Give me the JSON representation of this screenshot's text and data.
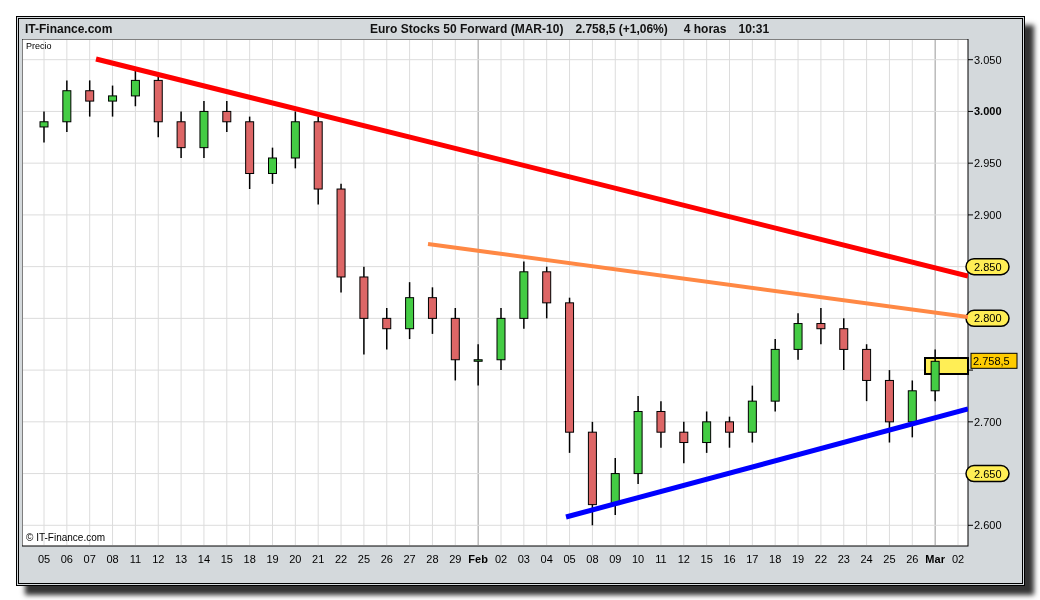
{
  "header": {
    "site": "IT-Finance.com",
    "title": "Euro Stocks 50 Forward (MAR-10)",
    "quote": "2.758,5 (+1,06%)",
    "interval": "4 horas",
    "time": "10:31"
  },
  "chart": {
    "panel_label": "Precio",
    "copyright": "© IT-Finance.com",
    "current_price": "2.758,5",
    "price_tick_bold": [
      false,
      true,
      false,
      false,
      false,
      false,
      false,
      false,
      false
    ],
    "price_tick_marked": [
      false,
      false,
      false,
      false,
      true,
      true,
      false,
      true,
      false
    ],
    "date_bold": [
      false,
      false,
      false,
      false,
      false,
      false,
      false,
      false,
      false,
      false,
      false,
      false,
      false,
      false,
      false,
      false,
      false,
      false,
      false,
      true,
      false,
      false,
      false,
      false,
      false,
      false,
      false,
      false,
      false,
      false,
      false,
      false,
      false,
      false,
      false,
      false,
      false,
      false,
      false,
      true,
      false
    ],
    "chart_data": {
      "type": "candlestick",
      "grid": true,
      "categories": [
        "05",
        "06",
        "07",
        "08",
        "11",
        "12",
        "13",
        "14",
        "15",
        "18",
        "19",
        "20",
        "21",
        "22",
        "25",
        "26",
        "27",
        "28",
        "29",
        "Feb",
        "02",
        "03",
        "04",
        "05",
        "08",
        "09",
        "10",
        "11",
        "12",
        "15",
        "16",
        "17",
        "18",
        "19",
        "22",
        "23",
        "24",
        "25",
        "26",
        "Mar",
        "02"
      ],
      "ylim": [
        2580,
        3070
      ],
      "yticks": [
        {
          "value": 3050,
          "label": "3.050"
        },
        {
          "value": 3000,
          "label": "3.000"
        },
        {
          "value": 2950,
          "label": "2.950"
        },
        {
          "value": 2900,
          "label": "2.900"
        },
        {
          "value": 2850,
          "label": "2.850"
        },
        {
          "value": 2800,
          "label": "2.800"
        },
        {
          "value": 2700,
          "label": "2.700"
        },
        {
          "value": 2650,
          "label": "2.650"
        },
        {
          "value": 2600,
          "label": "2.600"
        }
      ],
      "ohlc": [
        [
          2985,
          3000,
          2970,
          2990
        ],
        [
          2990,
          3030,
          2980,
          3020
        ],
        [
          3020,
          3030,
          2995,
          3010
        ],
        [
          3010,
          3025,
          2995,
          3015
        ],
        [
          3015,
          3040,
          3005,
          3030
        ],
        [
          3030,
          3035,
          2975,
          2990
        ],
        [
          2990,
          3000,
          2955,
          2965
        ],
        [
          2965,
          3010,
          2955,
          3000
        ],
        [
          3000,
          3010,
          2980,
          2990
        ],
        [
          2990,
          2995,
          2925,
          2940
        ],
        [
          2940,
          2965,
          2930,
          2955
        ],
        [
          2955,
          3000,
          2945,
          2990
        ],
        [
          2990,
          2995,
          2910,
          2925
        ],
        [
          2925,
          2930,
          2825,
          2840
        ],
        [
          2840,
          2850,
          2765,
          2800
        ],
        [
          2800,
          2810,
          2770,
          2790
        ],
        [
          2790,
          2835,
          2780,
          2820
        ],
        [
          2820,
          2830,
          2785,
          2800
        ],
        [
          2800,
          2810,
          2740,
          2760
        ],
        [
          2760,
          2775,
          2735,
          2760
        ],
        [
          2760,
          2810,
          2750,
          2800
        ],
        [
          2800,
          2855,
          2790,
          2845
        ],
        [
          2845,
          2850,
          2800,
          2815
        ],
        [
          2815,
          2820,
          2670,
          2690
        ],
        [
          2690,
          2700,
          2600,
          2620
        ],
        [
          2620,
          2665,
          2610,
          2650
        ],
        [
          2650,
          2725,
          2640,
          2710
        ],
        [
          2710,
          2720,
          2675,
          2690
        ],
        [
          2690,
          2700,
          2660,
          2680
        ],
        [
          2680,
          2710,
          2670,
          2700
        ],
        [
          2700,
          2705,
          2675,
          2690
        ],
        [
          2690,
          2735,
          2680,
          2720
        ],
        [
          2720,
          2780,
          2710,
          2770
        ],
        [
          2770,
          2805,
          2760,
          2795
        ],
        [
          2795,
          2810,
          2775,
          2790
        ],
        [
          2790,
          2800,
          2750,
          2770
        ],
        [
          2770,
          2775,
          2720,
          2740
        ],
        [
          2740,
          2750,
          2680,
          2700
        ],
        [
          2700,
          2740,
          2685,
          2730
        ],
        [
          2730,
          2770,
          2720,
          2758.5
        ],
        null
      ]
    }
  }
}
